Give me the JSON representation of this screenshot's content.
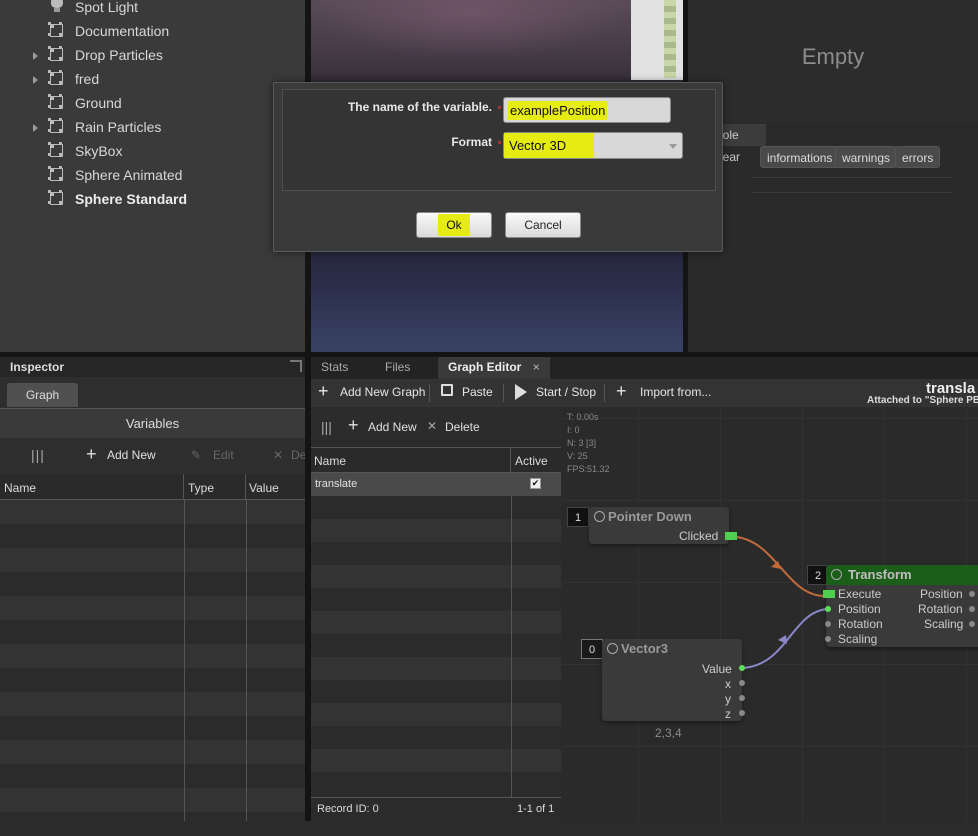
{
  "scene_tree": {
    "items": [
      {
        "label": "Spot Light",
        "icon": "light-bulb-icon",
        "expandable": false,
        "bold": false
      },
      {
        "label": "Documentation",
        "icon": "mesh-box-icon",
        "expandable": false,
        "bold": false
      },
      {
        "label": "Drop Particles",
        "icon": "mesh-box-icon",
        "expandable": true,
        "bold": false
      },
      {
        "label": "fred",
        "icon": "mesh-box-icon",
        "expandable": true,
        "bold": false
      },
      {
        "label": "Ground",
        "icon": "mesh-box-icon",
        "expandable": false,
        "bold": false
      },
      {
        "label": "Rain Particles",
        "icon": "mesh-box-icon",
        "expandable": true,
        "bold": false
      },
      {
        "label": "SkyBox",
        "icon": "mesh-box-icon",
        "expandable": false,
        "bold": false
      },
      {
        "label": "Sphere Animated",
        "icon": "mesh-box-icon",
        "expandable": false,
        "bold": false
      },
      {
        "label": "Sphere Standard",
        "icon": "mesh-box-icon",
        "expandable": false,
        "bold": true
      }
    ]
  },
  "preview": {
    "empty_label": "Empty"
  },
  "console": {
    "tab_label": "nole",
    "clear_label": "lear",
    "filters": [
      "informations",
      "warnings",
      "errors"
    ]
  },
  "dialog": {
    "name_label": "The name of the variable.",
    "name_value": "examplePosition",
    "format_label": "Format",
    "format_value": "Vector 3D",
    "ok_label": "Ok",
    "cancel_label": "Cancel",
    "highlight_color": "#e6ec12"
  },
  "inspector": {
    "title": "Inspector",
    "tab": "Graph",
    "section_title": "Variables",
    "toolbar": {
      "add_label": "Add New",
      "edit_label": "Edit",
      "delete_label": "De"
    },
    "columns": [
      "Name",
      "Type",
      "Value"
    ]
  },
  "graph_editor": {
    "tabs": [
      "Stats",
      "Files",
      "Graph Editor"
    ],
    "toolbar": {
      "add_graph": "Add New Graph",
      "paste": "Paste",
      "start_stop": "Start / Stop",
      "import": "Import from..."
    },
    "header_title": "transla",
    "header_subtitle": "Attached to \"Sphere PB",
    "list_toolbar": {
      "add_label": "Add New",
      "delete_label": "Delete"
    },
    "list_columns": [
      "Name",
      "Active"
    ],
    "graphs": [
      {
        "name": "translate",
        "active": true
      }
    ],
    "footer_record": "Record ID: 0",
    "footer_pager": "1-1 of 1",
    "stats": [
      "T: 0.00s",
      "I: 0",
      "N: 3 [3]",
      "V: 25",
      "FPS:51.32"
    ],
    "nodes": {
      "pointer_down": {
        "id": "1",
        "title": "Pointer Down",
        "output": "Clicked"
      },
      "transform": {
        "id": "2",
        "title": "Transform",
        "inputs": [
          "Execute",
          "Position",
          "Rotation",
          "Scaling"
        ],
        "outputs": [
          "Position",
          "Rotation",
          "Scaling"
        ],
        "header_color": "#1a5e1a"
      },
      "vector3": {
        "id": "0",
        "title": "Vector3",
        "outputs": [
          "Value",
          "x",
          "y",
          "z"
        ],
        "value_caption": "2,3,4"
      }
    },
    "link_colors": {
      "execute": "#c06a3c",
      "value": "#8a88c8"
    }
  }
}
